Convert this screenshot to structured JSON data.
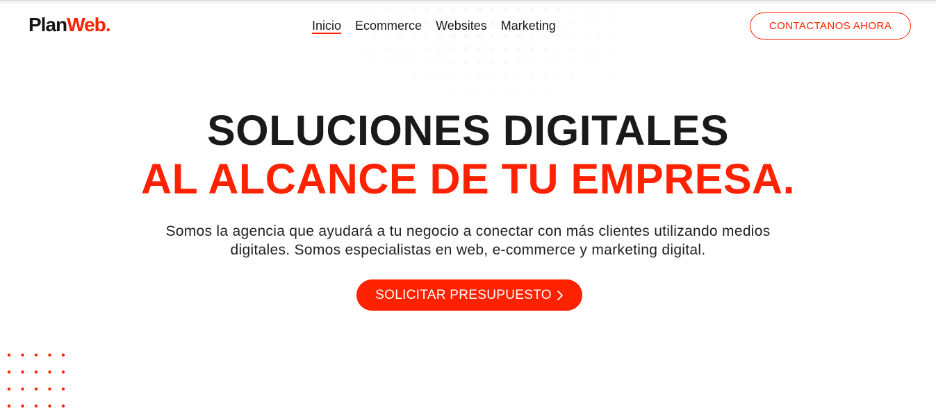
{
  "brand": {
    "logo_part1": "Plan",
    "logo_part2": "Web.",
    "accent_color": "#ff2200",
    "text_color": "#1a1a1a"
  },
  "nav": {
    "items": [
      {
        "label": "Inicio",
        "active": true
      },
      {
        "label": "Ecommerce",
        "active": false
      },
      {
        "label": "Websites",
        "active": false
      },
      {
        "label": "Marketing",
        "active": false
      }
    ],
    "contact_label": "CONTACTANOS AHORA"
  },
  "hero": {
    "title_line1": "SOLUCIONES DIGITALES",
    "title_line2": "AL ALCANCE DE TU EMPRESA.",
    "description": "Somos la agencia que ayudará a tu negocio a conectar con más clientes utilizando medios digitales. Somos especialistas en web, e-commerce y marketing digital.",
    "cta_label": "SOLICITAR PRESUPUESTO",
    "cta_icon": "chevron-right-icon"
  },
  "decorations": {
    "background_pattern_icon": "cross-pattern-icon",
    "dot_pattern_icon": "dot-grid-icon"
  }
}
